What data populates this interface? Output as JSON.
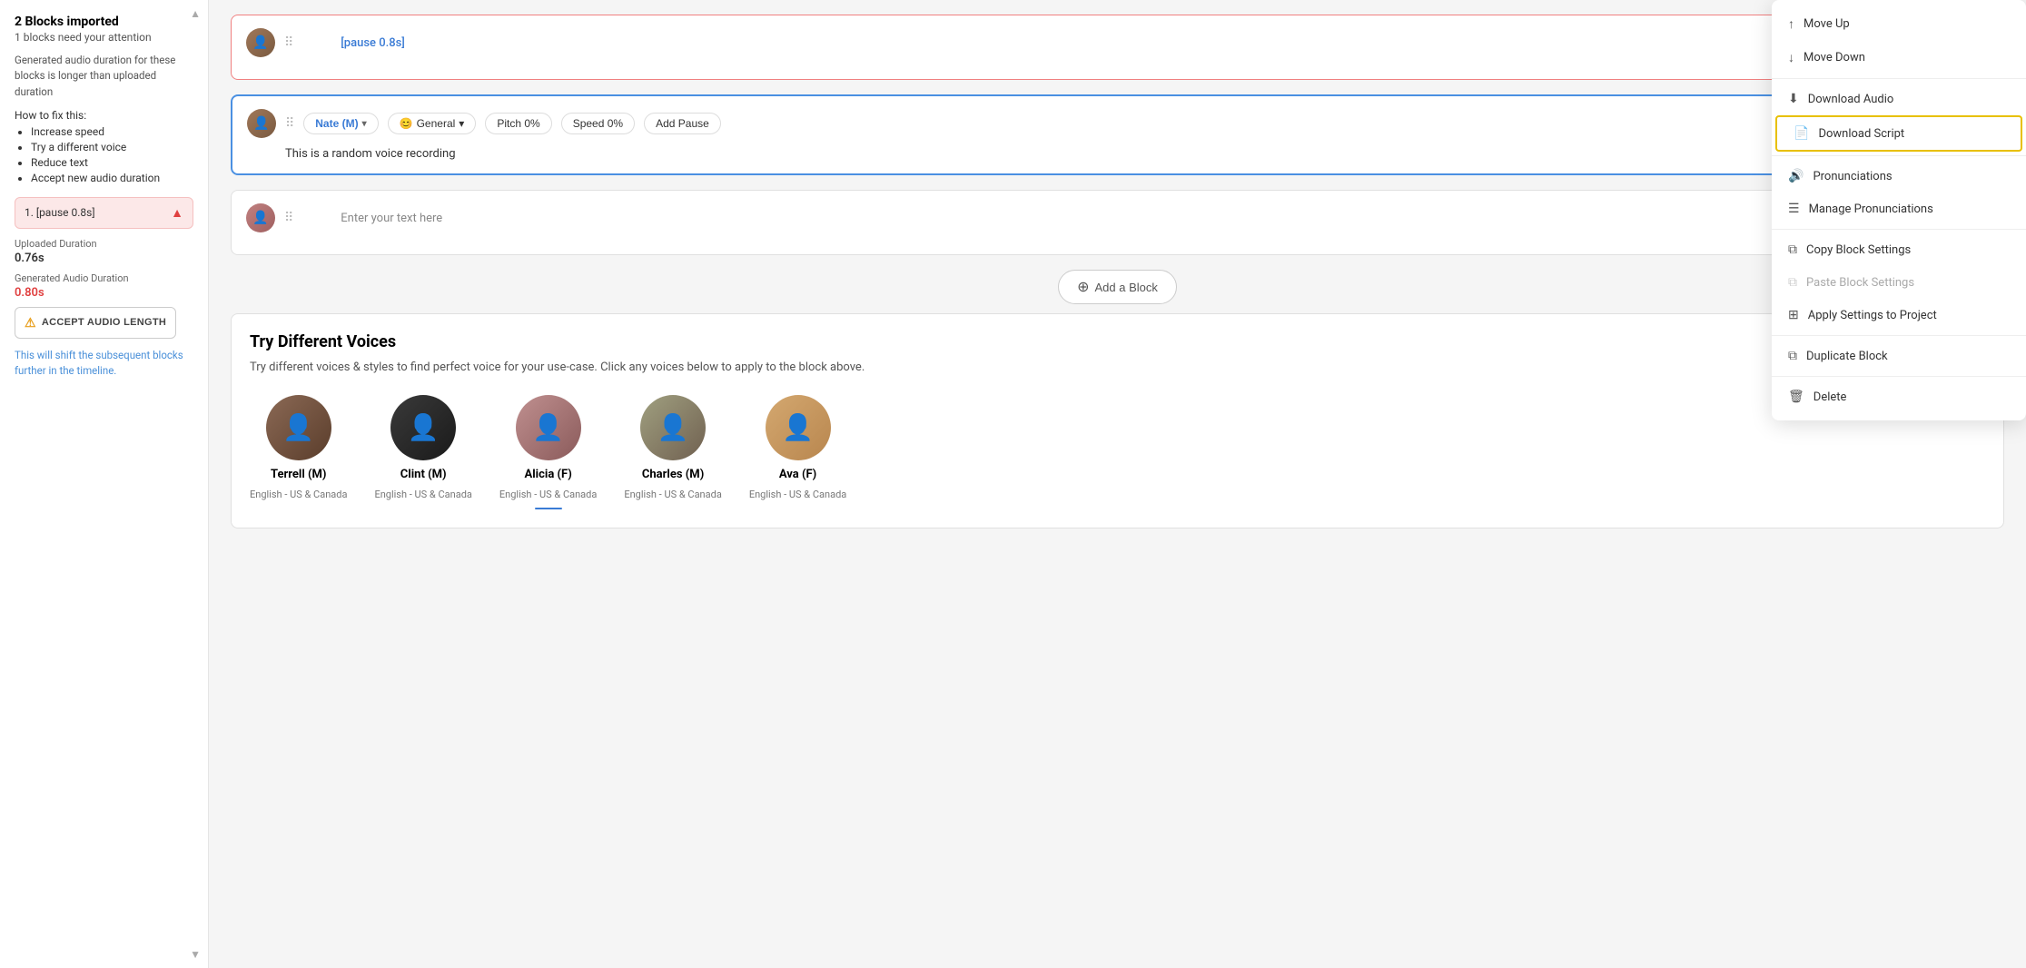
{
  "sidebar": {
    "title": "2 Blocks imported",
    "subtitle": "1 blocks need your attention",
    "desc": "Generated audio duration for these blocks is longer than uploaded duration",
    "how_to_fix": "How to fix this:",
    "fix_items": [
      "Increase speed",
      "Try a different voice",
      "Reduce text",
      "Accept new audio duration"
    ],
    "block_item_label": "1. [pause 0.8s]",
    "uploaded_duration_label": "Uploaded Duration",
    "uploaded_duration_value": "0.76s",
    "generated_label": "Generated Audio Duration",
    "generated_value": "0.80s",
    "accept_btn": "ACCEPT AUDIO LENGTH",
    "shift_note": "This will shift the subsequent blocks further in the timeline."
  },
  "blocks": [
    {
      "id": "block1",
      "type": "pause",
      "text": "[pause 0.8s]",
      "has_avatar": true,
      "avatar_type": "brown"
    },
    {
      "id": "block2",
      "type": "voice",
      "voice_name": "Nate (M)",
      "style": "General",
      "style_emoji": "😊",
      "pitch_label": "Pitch",
      "pitch_value": "0%",
      "speed_label": "Speed",
      "speed_value": "0%",
      "add_pause_label": "Add Pause",
      "text": "This is a random voice recording",
      "has_avatar": true,
      "avatar_type": "brown"
    },
    {
      "id": "block3",
      "type": "empty",
      "placeholder": "Enter your text here",
      "has_avatar": true,
      "avatar_type": "female"
    }
  ],
  "add_block_label": "Add a Block",
  "voices_panel": {
    "title": "Try Different Voices",
    "desc": "Try different voices & styles to find perfect voice for your use-case. Click any voices below to apply to the block above.",
    "voices": [
      {
        "name": "Terrell (M)",
        "lang": "English - US & Canada",
        "avatar_type": "v1",
        "has_underline": false
      },
      {
        "name": "Clint (M)",
        "lang": "English - US & Canada",
        "avatar_type": "v2",
        "has_underline": false
      },
      {
        "name": "Alicia (F)",
        "lang": "English - US & Canada",
        "avatar_type": "v3",
        "has_underline": true
      },
      {
        "name": "Charles (M)",
        "lang": "English - US & Canada",
        "avatar_type": "v4",
        "has_underline": false
      },
      {
        "name": "Ava (F)",
        "lang": "English - US & Canada",
        "avatar_type": "v5",
        "has_underline": false
      }
    ]
  },
  "context_menu": {
    "items": [
      {
        "id": "move-up",
        "label": "Move Up",
        "icon": "↑",
        "disabled": false
      },
      {
        "id": "move-down",
        "label": "Move Down",
        "icon": "↓",
        "disabled": false
      },
      {
        "divider": true
      },
      {
        "id": "download-audio",
        "label": "Download Audio",
        "icon": "⬇",
        "disabled": false
      },
      {
        "id": "download-script",
        "label": "Download Script",
        "icon": "📄",
        "disabled": false,
        "highlighted": true
      },
      {
        "divider": true
      },
      {
        "id": "pronunciations",
        "label": "Pronunciations",
        "icon": "🔊",
        "disabled": false
      },
      {
        "id": "manage-pronunciations",
        "label": "Manage Pronunciations",
        "icon": "☰",
        "disabled": false
      },
      {
        "divider": true
      },
      {
        "id": "copy-block-settings",
        "label": "Copy Block Settings",
        "icon": "⧉",
        "disabled": false
      },
      {
        "id": "paste-block-settings",
        "label": "Paste Block Settings",
        "icon": "⧉",
        "disabled": true
      },
      {
        "id": "apply-settings",
        "label": "Apply Settings to Project",
        "icon": "⊞",
        "disabled": false
      },
      {
        "divider": true
      },
      {
        "id": "duplicate-block",
        "label": "Duplicate Block",
        "icon": "⧉",
        "disabled": false
      },
      {
        "divider": true
      },
      {
        "id": "delete",
        "label": "Delete",
        "icon": "🗑",
        "disabled": false
      }
    ]
  }
}
